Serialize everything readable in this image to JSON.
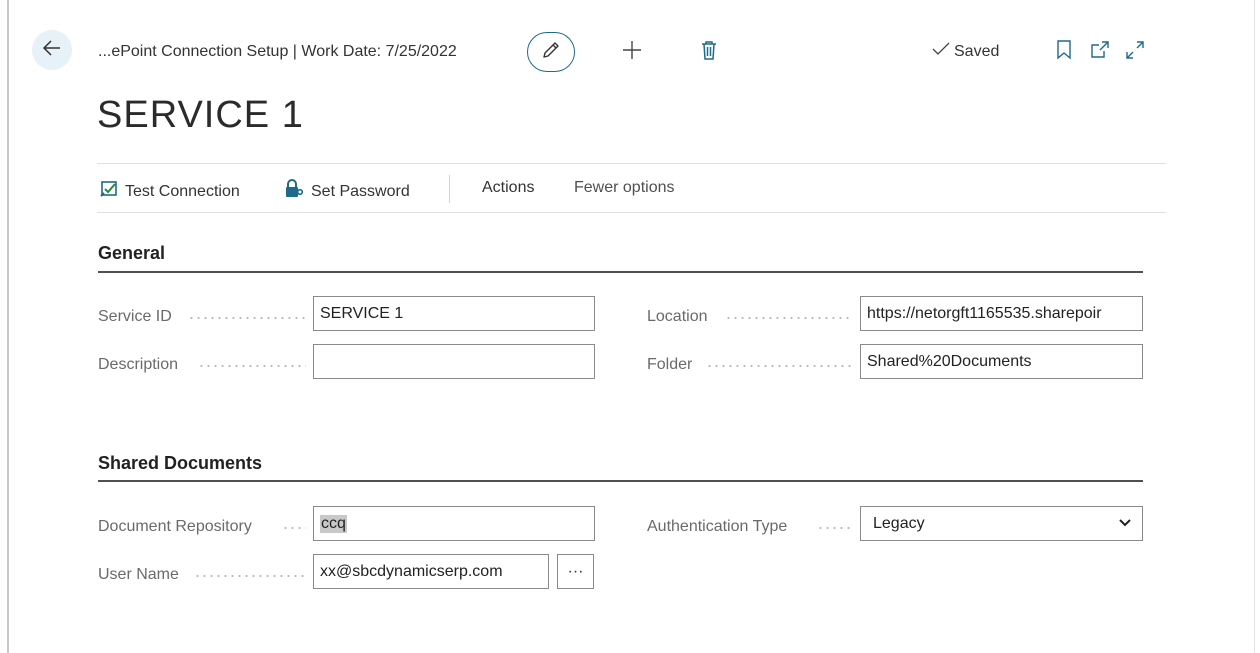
{
  "header": {
    "breadcrumb": "...ePoint Connection Setup | Work Date: 7/25/2022",
    "saved_label": "Saved"
  },
  "page_title": "SERVICE 1",
  "actions": {
    "test_connection": "Test Connection",
    "set_password": "Set Password",
    "actions_menu": "Actions",
    "fewer_options": "Fewer options"
  },
  "general": {
    "title": "General",
    "service_id": {
      "label": "Service ID",
      "value": "SERVICE 1"
    },
    "description": {
      "label": "Description",
      "value": ""
    },
    "location": {
      "label": "Location",
      "value": "https://netorgft1165535.sharepoir"
    },
    "folder": {
      "label": "Folder",
      "value": "Shared%20Documents"
    }
  },
  "shared_documents": {
    "title": "Shared Documents",
    "document_repository": {
      "label": "Document Repository",
      "value": "ccq"
    },
    "user_name": {
      "label": "User Name",
      "value": "xx@sbcdynamicserp.com"
    },
    "authentication_type": {
      "label": "Authentication Type",
      "value": "Legacy"
    },
    "lookup_label": "···"
  },
  "colors": {
    "accent": "#1e6a8a",
    "back_button_bg": "#e6f1f8",
    "section_rule": "#505050",
    "label_text": "#6a6a6a"
  },
  "icons": {
    "back": "arrow-left-icon",
    "edit": "pencil-icon",
    "new": "plus-icon",
    "delete": "trash-icon",
    "saved": "checkmark-icon",
    "bookmark": "bookmark-icon",
    "open_new_window": "open-new-window-icon",
    "expand": "expand-icon",
    "test_connection": "test-connection-icon",
    "set_password": "lock-key-icon",
    "dropdown": "chevron-down-icon"
  }
}
